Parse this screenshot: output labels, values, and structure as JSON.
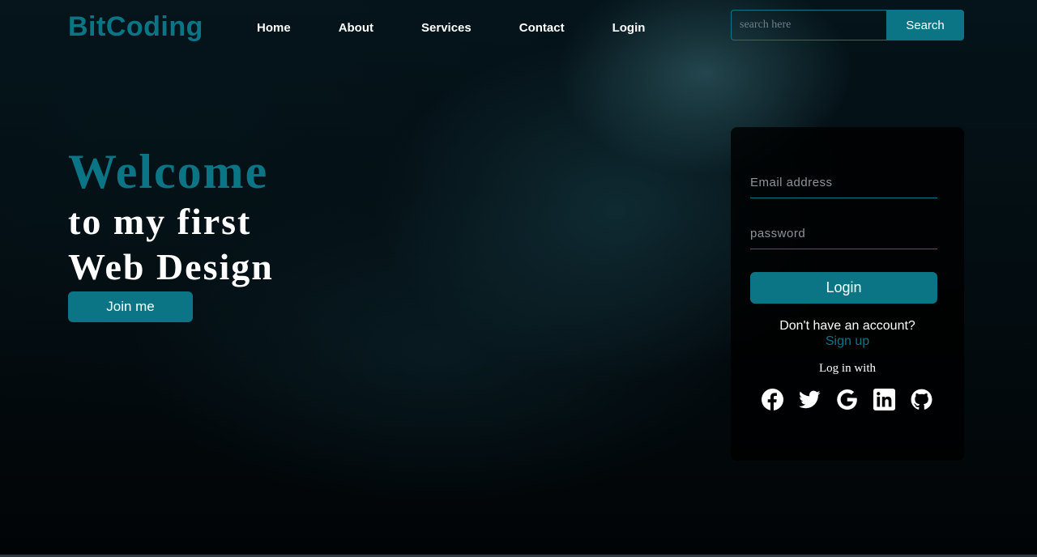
{
  "brand": {
    "name": "BitCoding",
    "accent_color": "#0b7585"
  },
  "nav": {
    "links": [
      "Home",
      "About",
      "Services",
      "Contact",
      "Login"
    ]
  },
  "search": {
    "placeholder": "search here",
    "button_label": "Search"
  },
  "hero": {
    "welcome": "Welcome",
    "line2": "to my first",
    "line3": "Web Design",
    "join_label": "Join me"
  },
  "login_form": {
    "email_placeholder": "Email address",
    "password_placeholder": "password",
    "login_label": "Login",
    "no_account_text": "Don't have an account?",
    "signup_label": "Sign up",
    "log_in_with": "Log in with",
    "social_icons": [
      "facebook-icon",
      "twitter-icon",
      "google-icon",
      "linkedin-icon",
      "github-icon"
    ]
  }
}
